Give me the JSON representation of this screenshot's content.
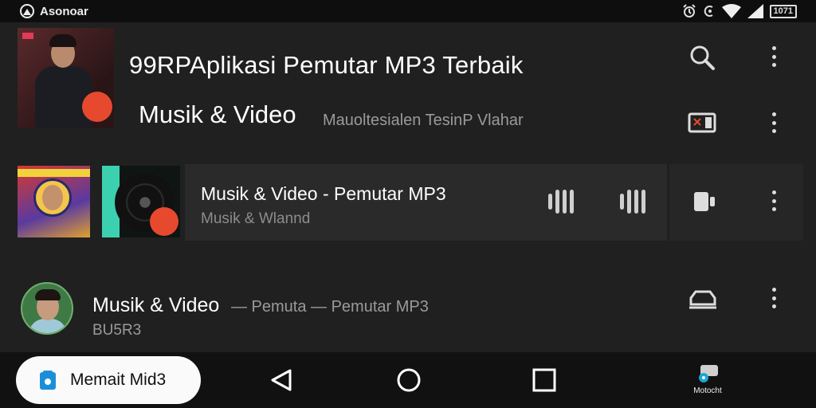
{
  "status_bar": {
    "app_name": "Asonoar",
    "battery_text": "1071",
    "icons": [
      "notification-icon",
      "alarm-icon",
      "data-icon",
      "wifi-icon",
      "signal-icon",
      "battery-icon"
    ]
  },
  "header": {
    "title_line1": "99RPAplikasi Pemutar MP3 Terbaik",
    "title_line2": "Musik & Video",
    "subtitle": "Mauoltesialen TesinP Vlahar",
    "actions": [
      "search-icon",
      "more-icon",
      "cast-icon",
      "more-icon"
    ]
  },
  "now_playing": {
    "title": "Musik & Video - Pemutar MP3",
    "subtitle": "Musik & Wlannd",
    "controls": [
      "equalizer-icon",
      "equalizer-icon",
      "device-icon",
      "more-icon"
    ]
  },
  "list_item": {
    "title": "Musik & Video",
    "meta": "— Pemuta  —  Pemutar MP3",
    "subtitle": "BU5R3",
    "actions": [
      "car-icon",
      "more-icon"
    ]
  },
  "nav": {
    "pill_label": "Memait Mid3",
    "app_label": "Motocht",
    "buttons": [
      "back-icon",
      "home-icon",
      "recents-icon"
    ]
  },
  "colors": {
    "background": "#202020",
    "highlight_row": "#2a2a2a",
    "accent": "#e6492e",
    "pill_bg": "#fafafa",
    "pill_icon": "#1a8fd8"
  }
}
